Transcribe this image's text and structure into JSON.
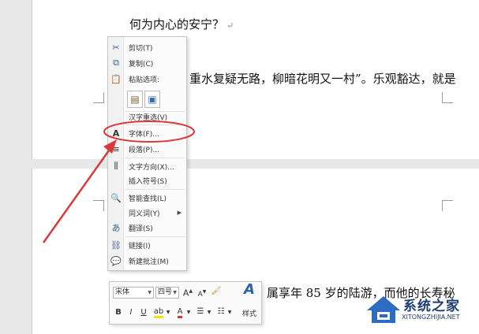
{
  "document": {
    "heading": "何为内心的安宁？",
    "paragraph_mark": "↵",
    "line2_fragment": "重水复疑无路，柳暗花明又一村”。乐观豁达，就是",
    "line3_fragment": "属享年 85 岁的陆游，而他的长寿秘"
  },
  "context_menu": {
    "items": [
      {
        "label": "剪切(T)",
        "icon": "scissors-icon"
      },
      {
        "label": "复制(C)",
        "icon": "copy-icon"
      },
      {
        "label": "粘贴选项:",
        "icon": "paste-icon"
      },
      {
        "label": "汉字重选(V)",
        "icon": ""
      },
      {
        "label": "字体(F)...",
        "icon": "font-a-icon"
      },
      {
        "label": "段落(P)...",
        "icon": "paragraph-icon"
      },
      {
        "label": "文字方向(X)...",
        "icon": "text-direction-icon"
      },
      {
        "label": "插入符号(S)",
        "icon": ""
      },
      {
        "label": "智能查找(L)",
        "icon": "smart-lookup-icon"
      },
      {
        "label": "同义词(Y)",
        "icon": ""
      },
      {
        "label": "翻译(S)",
        "icon": "translate-icon"
      },
      {
        "label": "链接(I)",
        "icon": "link-icon"
      },
      {
        "label": "新建批注(M)",
        "icon": "new-comment-icon"
      }
    ]
  },
  "mini_toolbar": {
    "font_name": "宋体",
    "font_size": "四号",
    "grow_font": "A",
    "shrink_font": "A",
    "bold": "B",
    "italic": "I",
    "underline": "U",
    "styles_label": "样式"
  },
  "watermark": {
    "title": "系统之家",
    "url": "XITONGZHIJIA.NET"
  },
  "colors": {
    "annotation_red": "#d9393a",
    "watermark_blue": "#1f3d73"
  }
}
